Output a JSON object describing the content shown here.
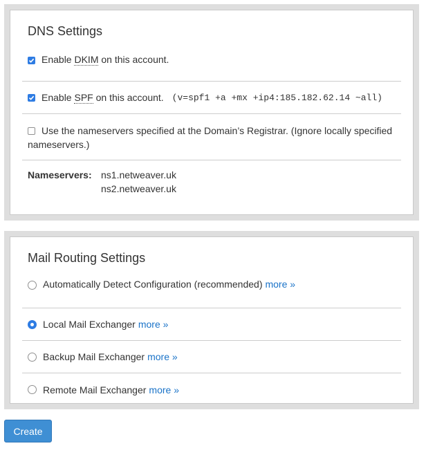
{
  "dns": {
    "title": "DNS Settings",
    "dkim": {
      "prefix": "Enable ",
      "abbr": "DKIM",
      "suffix": " on this account.",
      "checked": true
    },
    "spf": {
      "prefix": "Enable ",
      "abbr": "SPF",
      "suffix": " on this account.",
      "record": "(v=spf1 +a +mx +ip4:185.182.62.14 ~all)",
      "checked": true
    },
    "registrar": {
      "label": "Use the nameservers specified at the Domain’s Registrar. (Ignore locally specified nameservers.)",
      "checked": false
    },
    "nameservers": {
      "label": "Nameservers:",
      "values": [
        "ns1.netweaver.uk",
        "ns2.netweaver.uk"
      ]
    }
  },
  "mail_routing": {
    "title": "Mail Routing Settings",
    "more_label": "more »",
    "options": [
      {
        "label": "Automatically Detect Configuration (recommended)",
        "selected": false
      },
      {
        "label": "Local Mail Exchanger",
        "selected": true
      },
      {
        "label": "Backup Mail Exchanger",
        "selected": false
      },
      {
        "label": "Remote Mail Exchanger",
        "selected": false
      }
    ]
  },
  "create_label": "Create",
  "colors": {
    "accent": "#2e7ce3",
    "link": "#1a73c8",
    "button": "#3f8fd4",
    "panel_frame": "#dedede"
  }
}
